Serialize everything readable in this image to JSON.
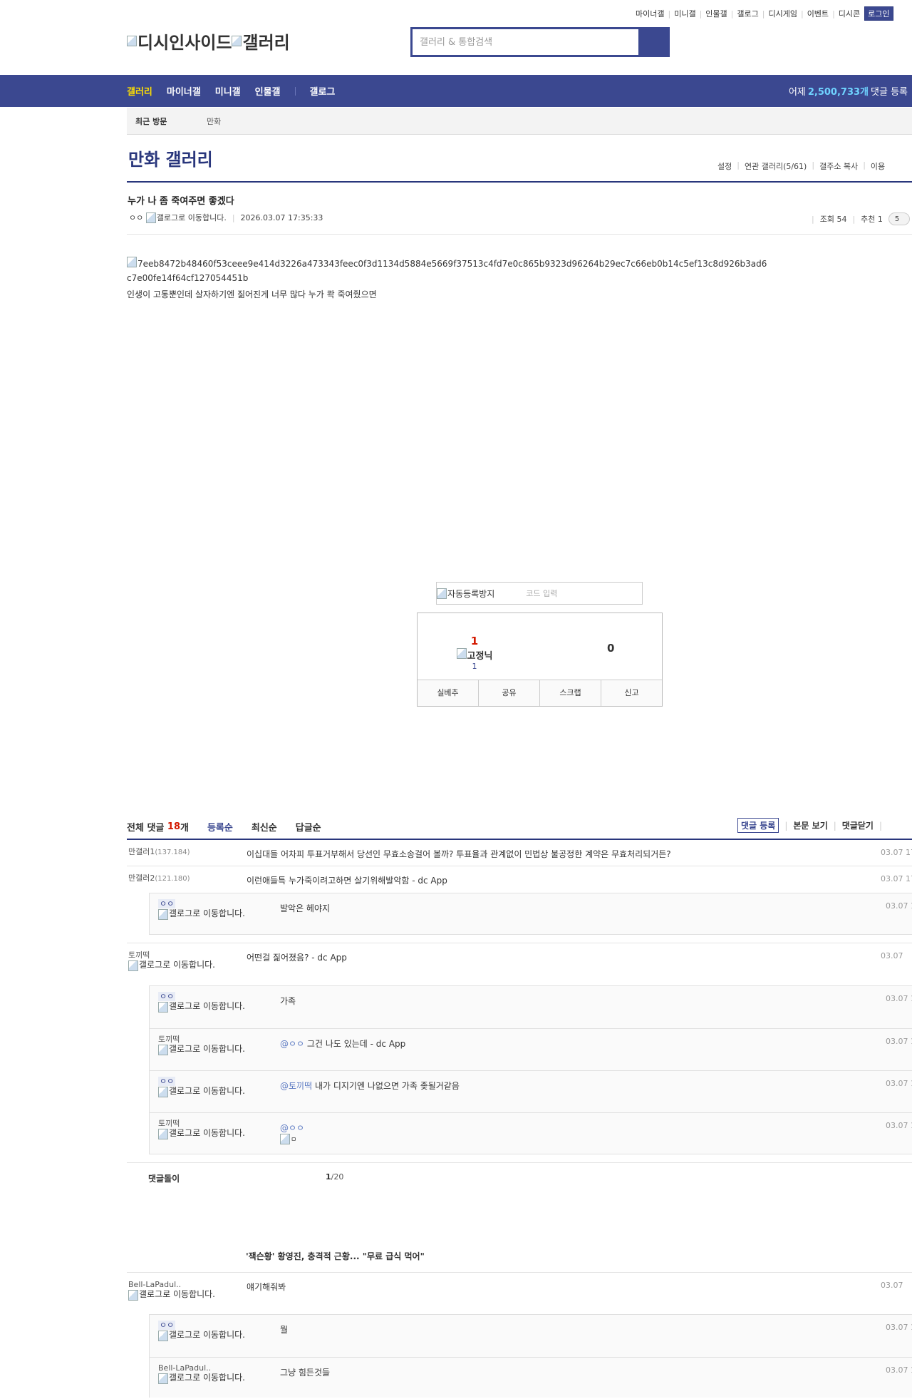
{
  "top_nav": {
    "items": [
      "마이너갤",
      "미니갤",
      "인물갤",
      "갤로그",
      "디시게임",
      "이벤트",
      "디시콘"
    ],
    "login": "로그인"
  },
  "logo": {
    "text1": "디시인사이드",
    "text2": "갤러리"
  },
  "search": {
    "placeholder": "갤러리 & 통합검색"
  },
  "gnb": {
    "items": [
      "갤러리",
      "마이너갤",
      "미니갤",
      "인물갤",
      "갤로그"
    ],
    "stat_prefix": "어제",
    "stat_count": "2,500,733개",
    "stat_suffix": "댓글 등록"
  },
  "recent": {
    "title": "최근 방문",
    "item": "만화"
  },
  "gallery": {
    "title": "만화 갤러리",
    "menu": [
      "설정",
      "연관 갤러리(5/61)",
      "갤주소 복사",
      "이용"
    ]
  },
  "post": {
    "title": "누가 나 좀 죽여주면 좋겠다",
    "author": "ㅇㅇ",
    "gallog_alt": "갤로그로 이동합니다.",
    "date": "2026.03.07 17:35:33",
    "views": "조회 54",
    "recommend": "추천 1",
    "comment_pill": "5",
    "image_alt": "7eeb8472b48460f53ceee9e414d3226a473343feec0f3d1134d5884e5669f37513c4fd7e0c865b9323d96264b29ec7c66eb0b14c5ef13c8d926b3ad6c7e00fe14f64cf127054451b",
    "body": "인생이 고통뿐인데 살자하기엔 짊어진게 너무 많다 누가 콱 죽여줬으면"
  },
  "captcha": {
    "img_alt": "자동등록방지",
    "placeholder": "코드 입력"
  },
  "recommend_box": {
    "up": "1",
    "fixed_alt": "고정닉",
    "fixed_count": "1",
    "down": "0",
    "buttons": [
      "실베추",
      "공유",
      "스크랩",
      "신고"
    ]
  },
  "comments_header": {
    "label": "전체 댓글",
    "count": "18",
    "unit": "개",
    "sorts": [
      "등록순",
      "최신순",
      "답글순"
    ],
    "actions": [
      "댓글 등록",
      "본문 보기",
      "댓글닫기"
    ]
  },
  "gallog_alt": "갤로그로 이동합니다.",
  "comments": [
    {
      "nick": "만갤러1",
      "ip": "(137.184)",
      "text": "이십대들 어차피 투표거부해서 당선인 무효소송걸어 볼까? 투표율과 관계없이 민법상 불공정한 계약은 무효처리되거든?",
      "date": "03.07 17:"
    },
    {
      "nick": "만갤러2",
      "ip": "(121.180)",
      "text": "이런애들특 누가죽이려고하면 살기위해발악함 - dc App",
      "date": "03.07 17:"
    },
    {
      "nick": "ㅇㅇ",
      "text": "발악은 헤야지",
      "date": "03.07 1"
    },
    {
      "nick": "토끼떡",
      "text": "어떤걸 짊어졌음? - dc App",
      "date": "03.07"
    },
    {
      "nick": "ㅇㅇ",
      "text": "가족",
      "date": "03.07 1"
    },
    {
      "nick": "토끼떡",
      "mention": "@ㅇㅇ",
      "text": "그건 나도 있는데 - dc App",
      "date": "03.07 1"
    },
    {
      "nick": "ㅇㅇ",
      "mention": "@토끼떡",
      "text": "내가 디지기엔 나없으면 가족 좆될거같음",
      "date": "03.07 1"
    },
    {
      "nick": "토끼떡",
      "mention": "@ㅇㅇ",
      "img_alt": "ㅁ",
      "date": "03.07 1"
    }
  ],
  "pager": {
    "label": "댓글돌이",
    "current": "1",
    "total": "/20"
  },
  "ad": {
    "title": "'잭슨황' 황영진, 충격적 근황... \"무료 급식 먹어\""
  },
  "comments2": [
    {
      "nick": "Bell-LaPadul..",
      "text": "얘기해줘봐",
      "date": "03.07"
    },
    {
      "nick": "ㅇㅇ",
      "text": "뭘",
      "date": "03.07 1"
    },
    {
      "nick": "Bell-LaPadul..",
      "text": "그냥 힘든것들",
      "date": "03.07 1"
    }
  ]
}
